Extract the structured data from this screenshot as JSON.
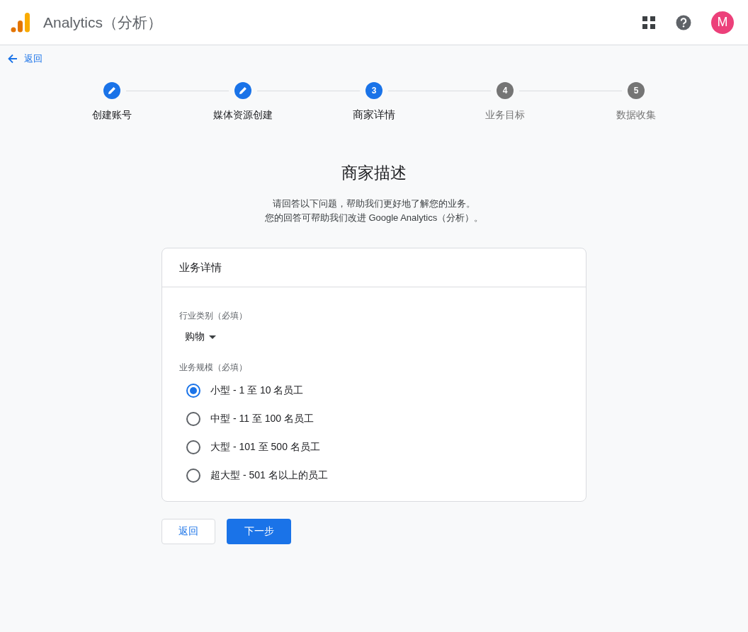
{
  "app_bar": {
    "title": "Analytics（分析）",
    "avatar": "M"
  },
  "back_link": "返回",
  "steps": [
    {
      "label": "创建账号",
      "kind": "done"
    },
    {
      "label": "媒体资源创建",
      "kind": "done"
    },
    {
      "label": "商家详情",
      "kind": "current",
      "number": "3"
    },
    {
      "label": "业务目标",
      "kind": "pending",
      "number": "4"
    },
    {
      "label": "数据收集",
      "kind": "pending",
      "number": "5"
    }
  ],
  "heading": "商家描述",
  "intro": [
    "请回答以下问题，帮助我们更好地了解您的业务。",
    "您的回答可帮助我们改进 Google Analytics（分析）。"
  ],
  "card": {
    "title": "业务详情",
    "industry": {
      "label": "行业类别（必填）",
      "value": "购物"
    },
    "size": {
      "label": "业务规模（必填）",
      "options": [
        {
          "label": "小型 - 1 至 10 名员工",
          "selected": true
        },
        {
          "label": "中型 - 11 至 100 名员工",
          "selected": false
        },
        {
          "label": "大型 - 101 至 500 名员工",
          "selected": false
        },
        {
          "label": "超大型 - 501 名以上的员工",
          "selected": false
        }
      ]
    }
  },
  "buttons": [
    {
      "label": "返回",
      "kind": "secondary"
    },
    {
      "label": "下一步",
      "kind": "primary"
    }
  ]
}
